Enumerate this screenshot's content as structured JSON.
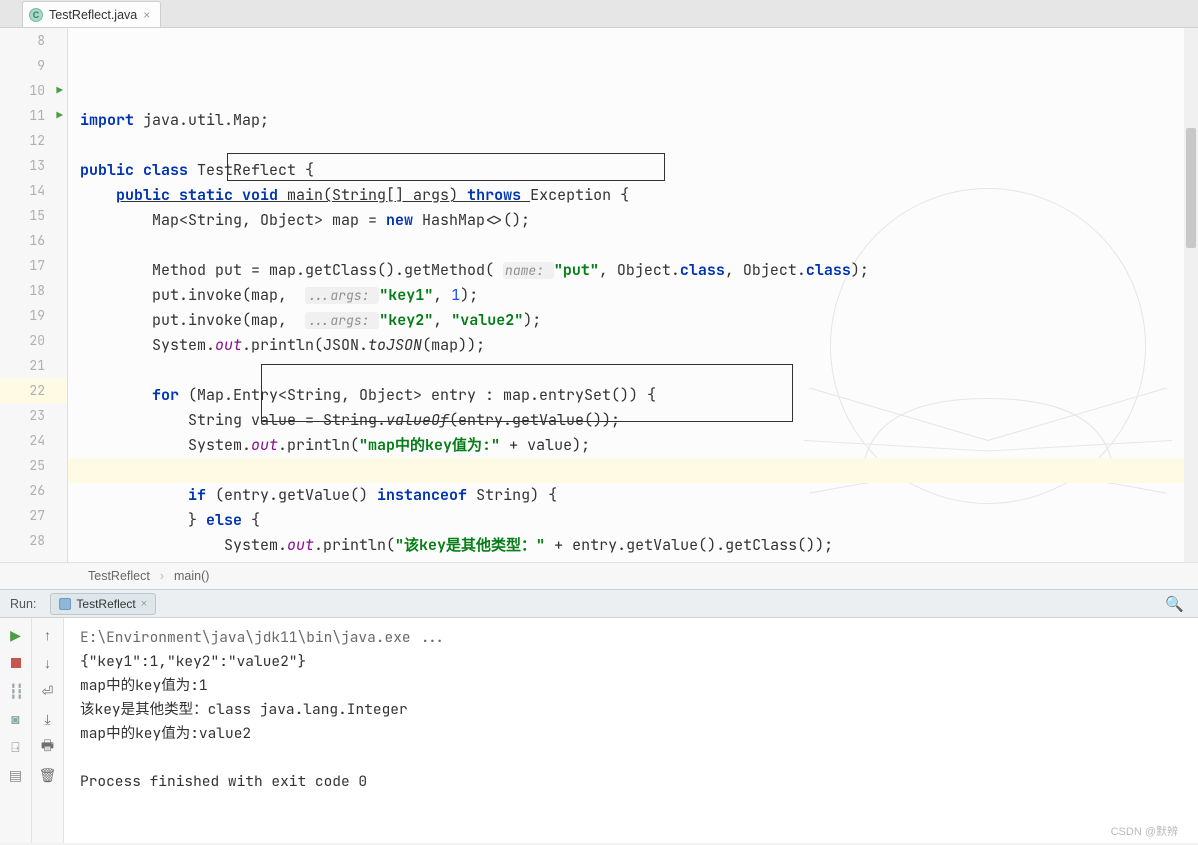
{
  "tab": {
    "filename": "TestReflect.java",
    "icon_letter": "C"
  },
  "gutter": {
    "start": 8,
    "end": 28,
    "run_markers": [
      10,
      11
    ],
    "highlighted": 22
  },
  "code_lines": {
    "8": {
      "segments": [
        {
          "t": "import ",
          "c": "kw1"
        },
        {
          "t": "java.util.Map;",
          "c": ""
        }
      ]
    },
    "9": {
      "segments": []
    },
    "10": {
      "segments": [
        {
          "t": "public class ",
          "c": "kw1"
        },
        {
          "t": "TestReflect {",
          "c": ""
        }
      ]
    },
    "11": {
      "segments": [
        {
          "t": "    ",
          "c": ""
        },
        {
          "t": "public static void ",
          "c": "kw1 under"
        },
        {
          "t": "main(String[] ",
          "c": "under"
        },
        {
          "t": "args",
          "c": "under"
        },
        {
          "t": ") ",
          "c": "under"
        },
        {
          "t": "throws ",
          "c": "kw1 under"
        },
        {
          "t": "Exception {",
          "c": ""
        }
      ]
    },
    "12": {
      "segments": [
        {
          "t": "        Map<String, Object> map = ",
          "c": ""
        },
        {
          "t": "new ",
          "c": "kw1"
        },
        {
          "t": "HashMap<>();",
          "c": ""
        }
      ]
    },
    "13": {
      "segments": []
    },
    "14": {
      "segments": [
        {
          "t": "        Method put = map.getClass().getMethod( ",
          "c": ""
        },
        {
          "t": "name: ",
          "c": "hint"
        },
        {
          "t": "\"put\"",
          "c": "str"
        },
        {
          "t": ", Object.",
          "c": ""
        },
        {
          "t": "class",
          "c": "kw1"
        },
        {
          "t": ", Object.",
          "c": ""
        },
        {
          "t": "class",
          "c": "kw1"
        },
        {
          "t": ");",
          "c": ""
        }
      ]
    },
    "15": {
      "segments": [
        {
          "t": "        put.invoke(map,  ",
          "c": ""
        },
        {
          "t": "...args: ",
          "c": "hint"
        },
        {
          "t": "\"key1\"",
          "c": "str"
        },
        {
          "t": ", ",
          "c": ""
        },
        {
          "t": "1",
          "c": "num"
        },
        {
          "t": ");",
          "c": ""
        }
      ]
    },
    "16": {
      "segments": [
        {
          "t": "        put.invoke(map,  ",
          "c": ""
        },
        {
          "t": "...args: ",
          "c": "hint"
        },
        {
          "t": "\"key2\"",
          "c": "str"
        },
        {
          "t": ", ",
          "c": ""
        },
        {
          "t": "\"value2\"",
          "c": "str"
        },
        {
          "t": ");",
          "c": ""
        }
      ]
    },
    "17": {
      "segments": [
        {
          "t": "        System.",
          "c": ""
        },
        {
          "t": "out",
          "c": "fld"
        },
        {
          "t": ".println(JSON.",
          "c": ""
        },
        {
          "t": "toJSON",
          "c": "mth"
        },
        {
          "t": "(map));",
          "c": ""
        }
      ]
    },
    "18": {
      "segments": []
    },
    "19": {
      "segments": [
        {
          "t": "        ",
          "c": ""
        },
        {
          "t": "for ",
          "c": "kw1"
        },
        {
          "t": "(Map.Entry<String, Object> entry : map.entrySet()) {",
          "c": ""
        }
      ]
    },
    "20": {
      "segments": [
        {
          "t": "            String value = String.",
          "c": ""
        },
        {
          "t": "valueOf",
          "c": "mth"
        },
        {
          "t": "(entry.getValue());",
          "c": ""
        }
      ]
    },
    "21": {
      "segments": [
        {
          "t": "            System.",
          "c": ""
        },
        {
          "t": "out",
          "c": "fld"
        },
        {
          "t": ".println(",
          "c": ""
        },
        {
          "t": "\"map中的key值为:\"",
          "c": "str"
        },
        {
          "t": " + value);",
          "c": ""
        }
      ]
    },
    "22": {
      "segments": []
    },
    "23": {
      "segments": [
        {
          "t": "            ",
          "c": ""
        },
        {
          "t": "if ",
          "c": "kw1"
        },
        {
          "t": "(entry.getValue() ",
          "c": ""
        },
        {
          "t": "instanceof ",
          "c": "kw1"
        },
        {
          "t": "String) {",
          "c": ""
        }
      ]
    },
    "24": {
      "segments": [
        {
          "t": "            } ",
          "c": ""
        },
        {
          "t": "else ",
          "c": "kw1"
        },
        {
          "t": "{",
          "c": ""
        }
      ]
    },
    "25": {
      "segments": [
        {
          "t": "                System.",
          "c": ""
        },
        {
          "t": "out",
          "c": "fld"
        },
        {
          "t": ".println(",
          "c": ""
        },
        {
          "t": "\"该key是其他类型：\"",
          "c": "str"
        },
        {
          "t": " + entry.getValue().getClass());",
          "c": ""
        }
      ]
    },
    "26": {
      "segments": [
        {
          "t": "            }",
          "c": ""
        }
      ]
    },
    "27": {
      "segments": [
        {
          "t": "        }",
          "c": ""
        }
      ]
    },
    "28": {
      "segments": [
        {
          "t": "    }",
          "c": ""
        }
      ]
    }
  },
  "breadcrumb": {
    "a": "TestReflect",
    "b": "main()"
  },
  "run": {
    "label": "Run:",
    "tab": "TestReflect",
    "console": [
      {
        "text": "E:\\Environment\\java\\jdk11\\bin\\java.exe ...",
        "cls": "cmd"
      },
      {
        "text": "{\"key1\":1,\"key2\":\"value2\"}",
        "cls": ""
      },
      {
        "text": "map中的key值为:1",
        "cls": ""
      },
      {
        "text": "该key是其他类型：class java.lang.Integer",
        "cls": ""
      },
      {
        "text": "map中的key值为:value2",
        "cls": ""
      },
      {
        "text": "",
        "cls": ""
      },
      {
        "text": "Process finished with exit code 0",
        "cls": "exit"
      }
    ]
  },
  "watermark": "CSDN @默辨"
}
